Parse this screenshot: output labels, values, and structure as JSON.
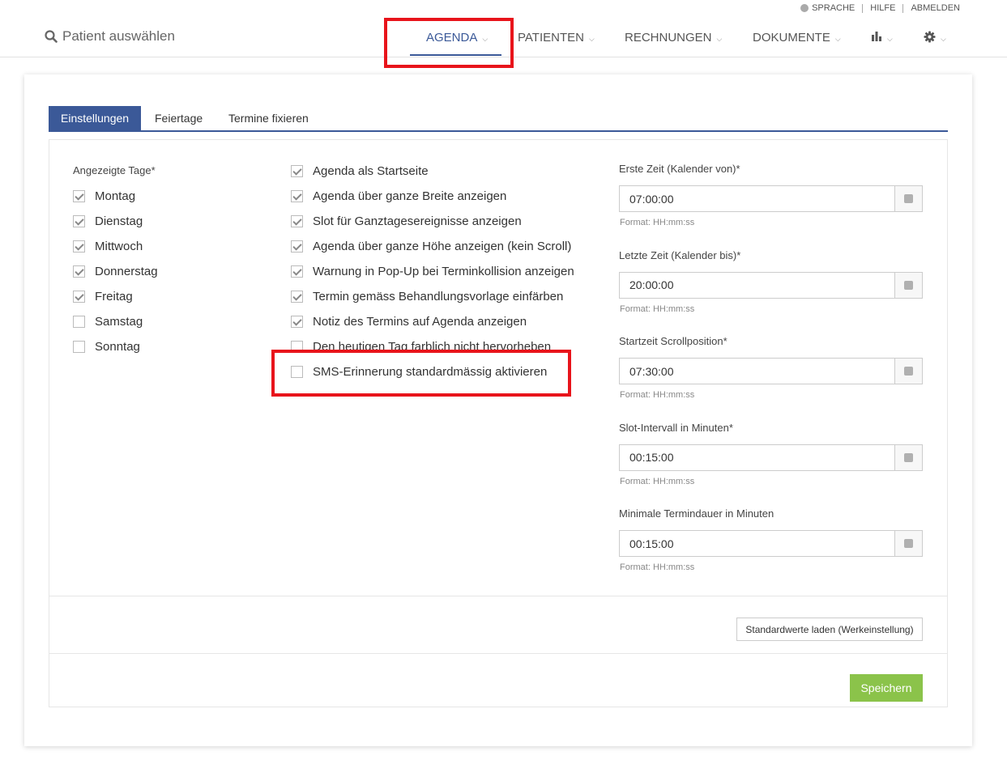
{
  "toplinks": {
    "language": "SPRACHE",
    "help": "HILFE",
    "logout": "ABMELDEN"
  },
  "header": {
    "patient_search": "Patient auswählen"
  },
  "nav": {
    "agenda": "AGENDA",
    "patients": "PATIENTEN",
    "invoices": "RECHNUNGEN",
    "documents": "DOKUMENTE"
  },
  "tabs": {
    "settings": "Einstellungen",
    "holidays": "Feiertage",
    "fix_appointments": "Termine fixieren"
  },
  "days": {
    "label": "Angezeigte Tage*",
    "items": [
      {
        "label": "Montag",
        "checked": true
      },
      {
        "label": "Dienstag",
        "checked": true
      },
      {
        "label": "Mittwoch",
        "checked": true
      },
      {
        "label": "Donnerstag",
        "checked": true
      },
      {
        "label": "Freitag",
        "checked": true
      },
      {
        "label": "Samstag",
        "checked": false
      },
      {
        "label": "Sonntag",
        "checked": false
      }
    ]
  },
  "options": {
    "items": [
      {
        "label": "Agenda als Startseite",
        "checked": true
      },
      {
        "label": "Agenda über ganze Breite anzeigen",
        "checked": true
      },
      {
        "label": "Slot für Ganztagesereignisse anzeigen",
        "checked": true
      },
      {
        "label": "Agenda über ganze Höhe anzeigen (kein Scroll)",
        "checked": true
      },
      {
        "label": "Warnung in Pop-Up bei Terminkollision anzeigen",
        "checked": true
      },
      {
        "label": "Termin gemäss Behandlungsvorlage einfärben",
        "checked": true
      },
      {
        "label": "Notiz des Termins auf Agenda anzeigen",
        "checked": true
      },
      {
        "label": "Den heutigen Tag farblich nicht hervorheben",
        "checked": false
      },
      {
        "label": "SMS-Erinnerung standardmässig aktivieren",
        "checked": false
      }
    ]
  },
  "fields": {
    "items": [
      {
        "label": "Erste Zeit (Kalender von)*",
        "value": "07:00:00",
        "hint": "Format: HH:mm:ss"
      },
      {
        "label": "Letzte Zeit (Kalender bis)*",
        "value": "20:00:00",
        "hint": "Format: HH:mm:ss"
      },
      {
        "label": "Startzeit Scrollposition*",
        "value": "07:30:00",
        "hint": "Format: HH:mm:ss"
      },
      {
        "label": "Slot-Intervall in Minuten*",
        "value": "00:15:00",
        "hint": "Format: HH:mm:ss"
      },
      {
        "label": "Minimale Termindauer in Minuten",
        "value": "00:15:00",
        "hint": "Format: HH:mm:ss"
      }
    ]
  },
  "buttons": {
    "load_defaults": "Standardwerte laden (Werkeinstellung)",
    "save": "Speichern"
  },
  "colors": {
    "accent": "#3b5998",
    "save": "#8bc34a",
    "highlight": "#e8141b"
  }
}
